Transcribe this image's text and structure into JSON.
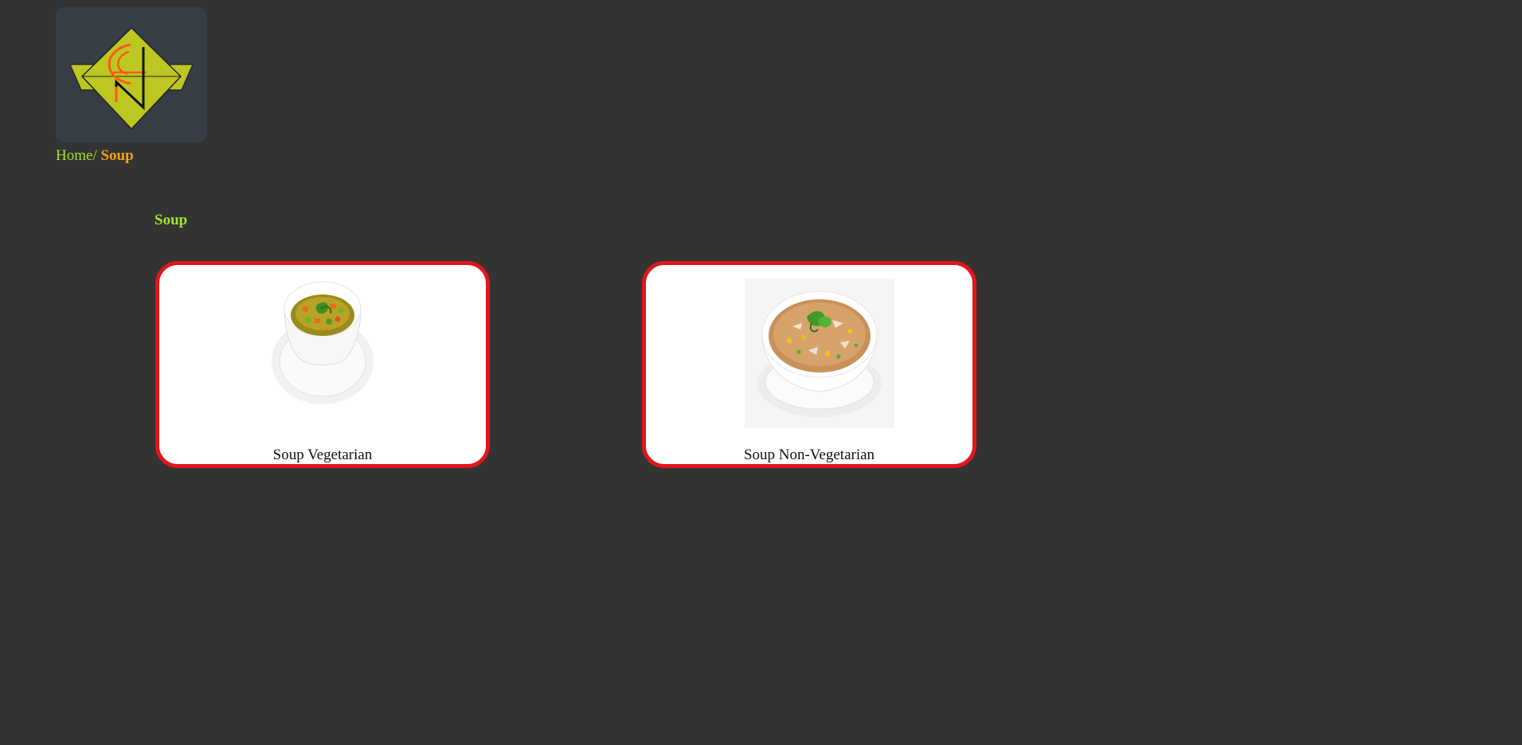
{
  "breadcrumb": {
    "home": "Home",
    "separator": "/",
    "current": "Soup"
  },
  "section": {
    "title": "Soup"
  },
  "cards": [
    {
      "label": "Soup Vegetarian",
      "image": "vegetable-soup-cup-image"
    },
    {
      "label": "Soup Non-Vegetarian",
      "image": "chicken-corn-soup-bowl-image"
    }
  ],
  "colors": {
    "page_background": "#333333",
    "logo_background": "#373d44",
    "logo_diamond": "#bdc722",
    "logo_accent": "#ff5a14",
    "breadcrumb_link": "#a6e22e",
    "breadcrumb_current": "#f0a01e",
    "section_title": "#a6e22e",
    "card_border": "#e0161c",
    "card_background": "#ffffff"
  }
}
